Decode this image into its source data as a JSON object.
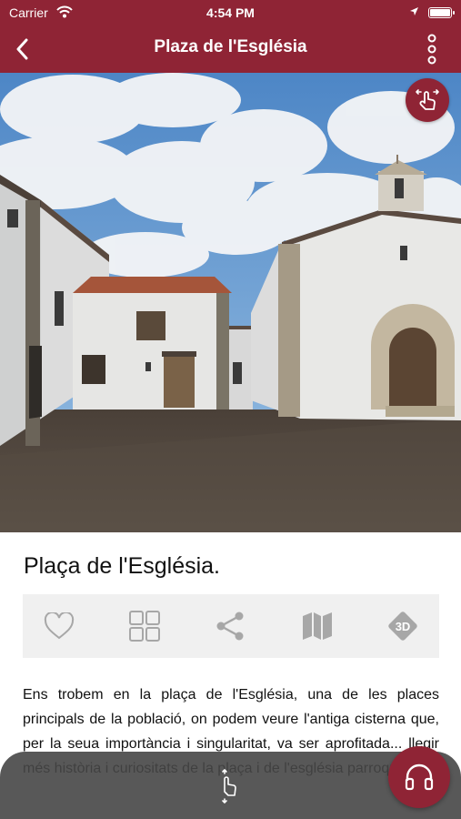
{
  "status_bar": {
    "carrier": "Carrier",
    "time": "4:54 PM",
    "battery_level": 1.0
  },
  "nav": {
    "title": "Plaza de l'Església"
  },
  "content": {
    "title": "Plaça de l'Església.",
    "description": "Ens trobem en la plaça de l'Església, una de les places principals de la població, on podem veure l'antiga cisterna que, per la seua importància i singularitat, va ser aprofitada... llegir més història i curiositats de la plaça i de l'església parroquial..."
  },
  "actions": [
    {
      "name": "favorite",
      "icon": "heart-icon"
    },
    {
      "name": "gallery",
      "icon": "grid-icon"
    },
    {
      "name": "share",
      "icon": "share-icon"
    },
    {
      "name": "map",
      "icon": "map-icon"
    },
    {
      "name": "3d",
      "icon": "3d-icon",
      "label": "3D"
    }
  ],
  "colors": {
    "brand": "#8f2435",
    "action_bar_bg": "#f0f0f0",
    "icon_gray": "#a7a7a7"
  }
}
